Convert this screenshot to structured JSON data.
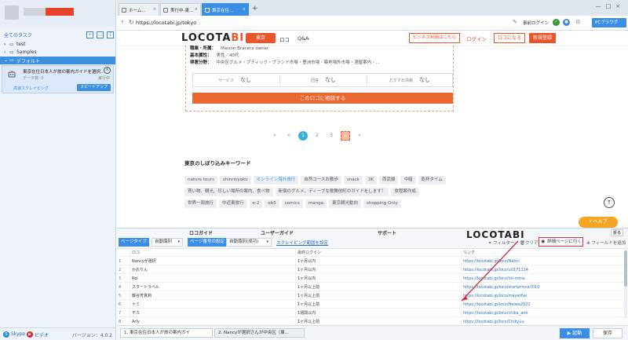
{
  "sidebar": {
    "all_tasks": "全てのタスク",
    "tree": [
      {
        "label": "test"
      },
      {
        "label": "Samples"
      },
      {
        "label": "デフォルト"
      }
    ],
    "task": {
      "title": "東京在住日本人が旅の案内ガイドを選択...",
      "sub": "データ数: 0",
      "status": "実行中",
      "mode": "高速スクレイピング",
      "speed_button": "スピードアップ"
    },
    "skype": "Skype",
    "video": "ビデオ",
    "version": "バージョン：4.0.2"
  },
  "browser": {
    "tabs": [
      {
        "label": "ホーム..."
      },
      {
        "label": "実行中-東..."
      },
      {
        "label": "東京在住..."
      }
    ],
    "url": "https://locotabi.jp/tokyo",
    "pre_login": "事前ログイン",
    "pc_browser": "PCブラウザ"
  },
  "site": {
    "logo_main": "LOCOTA",
    "logo_accent": "BI",
    "region": "東京",
    "nav_loco": "ロコ",
    "nav_qa": "Q&A",
    "biz": "ビジネス利用はこちら",
    "login": "ログイン",
    "become": "ロコになる",
    "signup": "新規登録",
    "profile": {
      "rows": [
        {
          "label": "職業・所属：",
          "value": "Maison Bracera owner"
        },
        {
          "label": "基本属性：",
          "value": "男性／40代"
        },
        {
          "label": "得意分野：",
          "value": "中央区グルメ・ブティック・ブランド市場・豊洲市場・築地場外市場・酒屋案内・..."
        }
      ],
      "stats": [
        {
          "label": "サービス",
          "value": "なし"
        },
        {
          "label": "回答",
          "value": "なし"
        },
        {
          "label": "おすすめ情報",
          "value": "なし"
        }
      ],
      "consult": "このロコに相談する"
    },
    "pager": [
      "«",
      "<",
      "1",
      "2",
      "3",
      ">",
      "»"
    ],
    "keywords_title": "東京のしぼり込みキーワード",
    "keywords": [
      {
        "t": "nature tours",
        "hl": false
      },
      {
        "t": "shinrinyoku",
        "hl": false
      },
      {
        "t": "オンライン海外旅行",
        "hl": true
      },
      {
        "t": "自然コースお散歩",
        "hl": false
      },
      {
        "t": "snack",
        "hl": false
      },
      {
        "t": "3K",
        "hl": false
      },
      {
        "t": "西武線",
        "hl": false
      },
      {
        "t": "中暗",
        "hl": false
      },
      {
        "t": "乾杯タイム",
        "hl": false
      },
      {
        "t": "買い物、観光、珍しい場所の案内、食べ物",
        "hl": false
      },
      {
        "t": "新宿のグルメ、ディープな歌舞伎町のガイドをします！",
        "hl": false
      },
      {
        "t": "旅程案作成",
        "hl": false
      },
      {
        "t": "世界一周旅行",
        "hl": false
      },
      {
        "t": "中近東旅行",
        "hl": false
      },
      {
        "t": "e-2",
        "hl": false
      },
      {
        "t": "eb5",
        "hl": false
      },
      {
        "t": "comics",
        "hl": false
      },
      {
        "t": "manga",
        "hl": false
      },
      {
        "t": "東京観光動向",
        "hl": false
      },
      {
        "t": "shopping Only",
        "hl": false
      }
    ],
    "help": "ヘルプ"
  },
  "panel": {
    "footer_peek": [
      "ロコガイド",
      "ユーザーガイド",
      "サポート"
    ],
    "footer_logo": "LOCOTABI",
    "fold": "折る",
    "page_type_tag": "ページタイプ",
    "page_type_value": "自動識別",
    "page_num_tag": "ページ番号の設定",
    "page_num_value": "自動識別(成功)",
    "scrape_range": "スクレイピング範囲を設定",
    "filter": "フィルター",
    "clear": "クリア",
    "goto_detail": "詳細ページに行く",
    "add_field": "フィールドを追加",
    "columns": [
      "ロコ",
      "最終ログイン",
      "リンク"
    ],
    "rows": [
      {
        "n": "1",
        "name": "Nancyが選択",
        "login": "1ヶ月以内",
        "link": "https://locotabi.jp/loco/Nanci"
      },
      {
        "n": "2",
        "name": "かおりん",
        "login": "1ヶ月以内",
        "link": "https://locotabi.jp/loco/u0171114"
      },
      {
        "n": "3",
        "name": "Roi",
        "login": "1ヶ月以内",
        "link": "https://locotabi.jp/loco/roi-roma"
      },
      {
        "n": "4",
        "name": "スタートラベル",
        "login": "1ヶ月以上前",
        "link": "https://locotabi.jp/loco/startprince7010"
      },
      {
        "n": "5",
        "name": "藤谷芳真莉",
        "login": "1ヶ月以上前",
        "link": "https://locotabi.jp/loco/mayathai"
      },
      {
        "n": "6",
        "name": "ナミ",
        "login": "1ヶ月以上前",
        "link": "https://locotabi.jp/loco/Heiwa2022"
      },
      {
        "n": "7",
        "name": "チカ",
        "login": "1週間以内",
        "link": "https://locotabi.jp/loco/chika_ami"
      },
      {
        "n": "8",
        "name": "Arly",
        "login": "1ヶ月以上前",
        "link": "https://locotabi.jp/loco/Chikyuu"
      }
    ],
    "bottom_tabs": [
      "1. 東京在住日本人が旅の案内ガイ",
      "2. Nancyが選択さんが中央区（東..."
    ],
    "run": "起動",
    "save": "保存"
  }
}
